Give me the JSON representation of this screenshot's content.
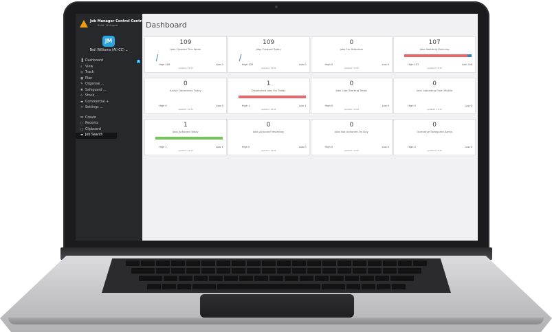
{
  "app": {
    "title": "Job Manager Control Centre",
    "build": "Build: 16 August",
    "logo_text": "JM",
    "user": "Neil Williams (All CC) ⌄"
  },
  "colors": {
    "sidebar_bg": "#26282b",
    "accent_blue": "#2aa5e0",
    "brand_orange": "#f39c12",
    "bar_red": "#e8696b",
    "bar_green": "#72c556",
    "bar_blue": "#3b82c4"
  },
  "nav": [
    {
      "label": "Dashboard",
      "icon": "chart-icon",
      "glyph": "▐",
      "badge": "1"
    },
    {
      "label": "View",
      "icon": "search-icon",
      "glyph": "⌕"
    },
    {
      "label": "Track",
      "icon": "target-icon",
      "glyph": "◎"
    },
    {
      "label": "Plan",
      "icon": "calendar-icon",
      "glyph": "▦"
    },
    {
      "label": "Organise ...",
      "icon": "wrench-icon",
      "glyph": "✎"
    },
    {
      "label": "Safeguard ...",
      "icon": "shield-icon",
      "glyph": "✱"
    },
    {
      "label": "Stock ...",
      "icon": "box-icon",
      "glyph": "⌂"
    },
    {
      "label": "Commercial +",
      "icon": "briefcase-icon",
      "glyph": "▬"
    },
    {
      "label": "Settings ...",
      "icon": "tools-icon",
      "glyph": "✕"
    },
    {
      "label": "Create",
      "icon": "plus-box-icon",
      "glyph": "⊞"
    },
    {
      "label": "Recents",
      "icon": "clock-icon",
      "glyph": "▯"
    },
    {
      "label": "Clipboard",
      "icon": "clipboard-icon",
      "glyph": "▢"
    },
    {
      "label": "Job Search",
      "icon": "folder-icon",
      "glyph": "▬"
    }
  ],
  "page_title": "Dashboard",
  "cards": [
    {
      "value": "109",
      "label": "Jobs Created This Week",
      "high": "High 109",
      "low": "Low 0",
      "updated": "updated: 14:45",
      "bar": "tick"
    },
    {
      "value": "109",
      "label": "Jobs Created Today",
      "high": "High 109",
      "low": "Low 0",
      "updated": "updated: 14:45",
      "bar": "tick"
    },
    {
      "value": "0",
      "label": "Jobs For Attention",
      "high": "High 0",
      "low": "Low 0",
      "updated": "updated: 14:45",
      "bar": "none"
    },
    {
      "value": "107",
      "label": "Jobs Awaiting Planning",
      "high": "High 107",
      "low": "Low 100",
      "updated": "updated: 14:45",
      "bar": "red-blue",
      "level": 0.94
    },
    {
      "value": "0",
      "label": "Active Operatives Today",
      "high": "High 0",
      "low": "Low 0",
      "updated": "updated: 14:45",
      "bar": "none"
    },
    {
      "value": "1",
      "label": "Dispatched Jobs For Today",
      "high": "High 1",
      "low": "Low 1",
      "updated": "updated: 14:45",
      "bar": "red",
      "level": 1.0
    },
    {
      "value": "0",
      "label": "Jobs Late Starting Today",
      "high": "High 0",
      "low": "Low 0",
      "updated": "updated: 14:45",
      "bar": "none"
    },
    {
      "value": "0",
      "label": "Jobs Uploading From Mobile",
      "high": "High 0",
      "low": "Low 0",
      "updated": "updated: 14:45",
      "bar": "none"
    },
    {
      "value": "1",
      "label": "Jobs Actioned Today",
      "high": "High 1",
      "low": "Low 1",
      "updated": "updated: 14:45",
      "bar": "green",
      "level": 1.0
    },
    {
      "value": "0",
      "label": "Jobs Actioned Yesterday",
      "high": "High 0",
      "low": "Low 0",
      "updated": "updated: 14:45",
      "bar": "none"
    },
    {
      "value": "0",
      "label": "Jobs Not Actioned On Day",
      "high": "High 0",
      "low": "Low 0",
      "updated": "updated: 14:45",
      "bar": "none"
    },
    {
      "value": "0",
      "label": "Operative Safeguard Alerts",
      "high": "High 0",
      "low": "Low 0",
      "updated": "updated: 14:45",
      "bar": "none"
    }
  ]
}
